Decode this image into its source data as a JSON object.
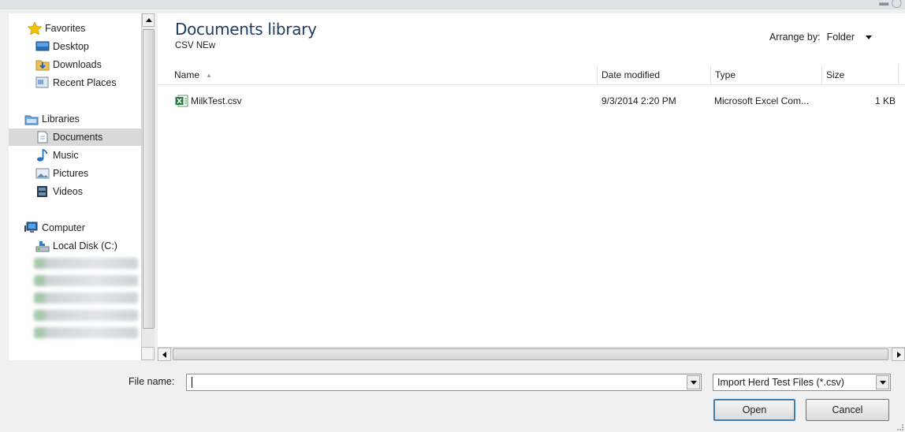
{
  "navigation": {
    "favorites_label": "Favorites",
    "desktop_label": "Desktop",
    "downloads_label": "Downloads",
    "recent_places_label": "Recent Places",
    "libraries_label": "Libraries",
    "documents_label": "Documents",
    "music_label": "Music",
    "pictures_label": "Pictures",
    "videos_label": "Videos",
    "computer_label": "Computer",
    "local_disk_label": "Local Disk (C:)"
  },
  "content": {
    "library_title": "Documents library",
    "library_subtitle": "CSV NEw",
    "arrange_by_label": "Arrange by:",
    "arrange_by_value": "Folder",
    "columns": {
      "name": "Name",
      "date_modified": "Date modified",
      "type": "Type",
      "size": "Size"
    },
    "files": [
      {
        "name": "MilkTest.csv",
        "date_modified": "9/3/2014 2:20 PM",
        "type": "Microsoft Excel Com...",
        "size": "1 KB"
      }
    ]
  },
  "footer": {
    "file_name_label": "File name:",
    "file_name_value": "",
    "file_type_value": "Import Herd Test Files (*.csv)",
    "open_button": "Open",
    "cancel_button": "Cancel"
  },
  "colors": {
    "title_blue": "#1e3a5f",
    "selected_bg": "#d9d9d9",
    "open_button_border": "#3c7fb1"
  }
}
